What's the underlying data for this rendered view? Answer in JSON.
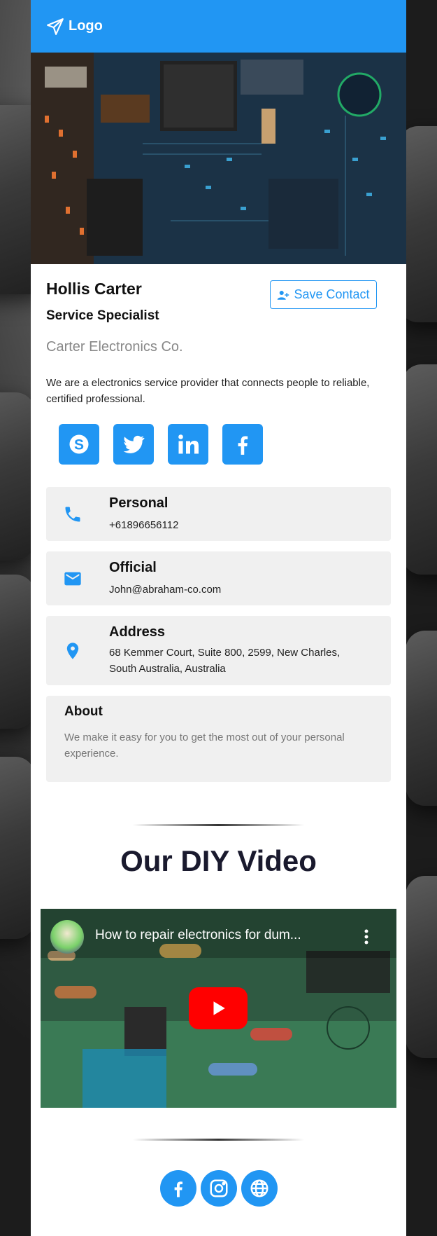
{
  "header": {
    "logo_text": "Logo",
    "logo_icon": "paper-plane-icon"
  },
  "profile": {
    "name": "Hollis Carter",
    "job_title": "Service Specialist",
    "company": "Carter Electronics Co.",
    "save_contact_label": "Save Contact",
    "bio": "We are a electronics service provider that connects people to reliable, certified professional."
  },
  "socials": [
    {
      "name": "skype-icon"
    },
    {
      "name": "twitter-icon"
    },
    {
      "name": "linkedin-icon"
    },
    {
      "name": "facebook-icon"
    }
  ],
  "contacts": {
    "personal": {
      "title": "Personal",
      "value": "+61896656112"
    },
    "official": {
      "title": "Official",
      "value": "John@abraham-co.com"
    },
    "address": {
      "title": "Address",
      "value": "68 Kemmer Court, Suite 800, 2599, New Charles, South Australia, Australia"
    }
  },
  "about": {
    "title": "About",
    "text": "We make it easy for you to get the most out of your personal experience."
  },
  "video_section": {
    "heading": "Our DIY Video",
    "video_title": "How to repair electronics for dum..."
  },
  "footer_socials": [
    {
      "name": "facebook-icon"
    },
    {
      "name": "instagram-icon"
    },
    {
      "name": "globe-icon"
    }
  ],
  "colors": {
    "accent": "#2196f3",
    "card_bg": "#ffffff",
    "box_bg": "#f0f0f0"
  }
}
